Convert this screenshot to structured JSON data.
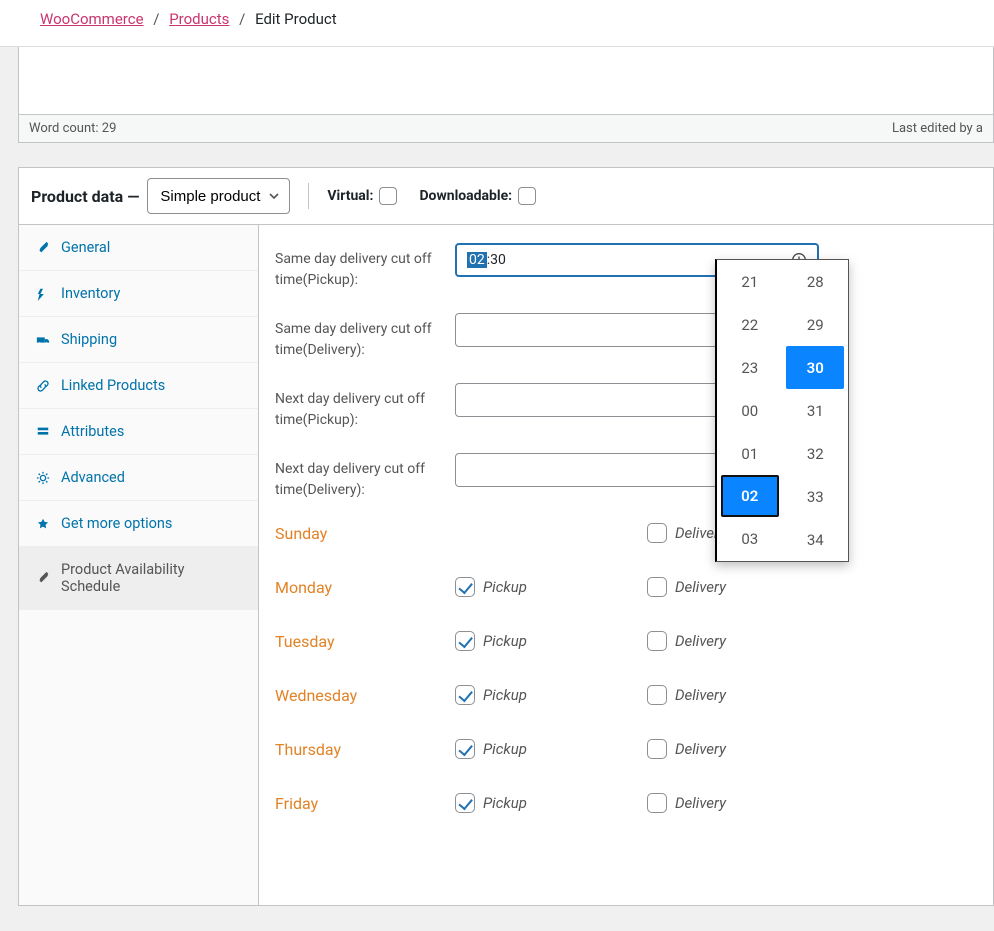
{
  "breadcrumb": {
    "root": "WooCommerce",
    "section": "Products",
    "current": "Edit Product"
  },
  "status": {
    "word_count_label": "Word count: 29",
    "last_edited": "Last edited by a"
  },
  "panel": {
    "title_prefix": "Product data",
    "title_dash": " — ",
    "product_type": "Simple product",
    "virtual_label": "Virtual:",
    "downloadable_label": "Downloadable:"
  },
  "tabs": [
    {
      "key": "general",
      "label": "General"
    },
    {
      "key": "inventory",
      "label": "Inventory"
    },
    {
      "key": "shipping",
      "label": "Shipping"
    },
    {
      "key": "linked",
      "label": "Linked Products"
    },
    {
      "key": "attributes",
      "label": "Attributes"
    },
    {
      "key": "advanced",
      "label": "Advanced"
    },
    {
      "key": "getmore",
      "label": "Get more options"
    },
    {
      "key": "schedule",
      "label": "Product Availability Schedule"
    }
  ],
  "fields": {
    "f0": {
      "label": "Same day delivery cut off time(Pickup):",
      "value_sel": "02",
      "value_rest": ":30"
    },
    "f1": {
      "label": "Same day delivery cut off time(Delivery):"
    },
    "f2": {
      "label": "Next day delivery cut off time(Pickup):"
    },
    "f3": {
      "label": "Next day delivery cut off time(Delivery):"
    }
  },
  "dropdown": {
    "hours": [
      "21",
      "22",
      "23",
      "00",
      "01",
      "02",
      "03"
    ],
    "minutes": [
      "28",
      "29",
      "30",
      "31",
      "32",
      "33",
      "34"
    ],
    "hour_selected": "02",
    "minute_selected": "30"
  },
  "labels": {
    "pickup": "Pickup",
    "delivery": "Delivery"
  },
  "days": [
    {
      "name": "Sunday",
      "pickup": false,
      "delivery": false,
      "show_pickup": false
    },
    {
      "name": "Monday",
      "pickup": true,
      "delivery": false,
      "show_pickup": true
    },
    {
      "name": "Tuesday",
      "pickup": true,
      "delivery": false,
      "show_pickup": true
    },
    {
      "name": "Wednesday",
      "pickup": true,
      "delivery": false,
      "show_pickup": true
    },
    {
      "name": "Thursday",
      "pickup": true,
      "delivery": false,
      "show_pickup": true
    },
    {
      "name": "Friday",
      "pickup": true,
      "delivery": false,
      "show_pickup": true
    }
  ]
}
